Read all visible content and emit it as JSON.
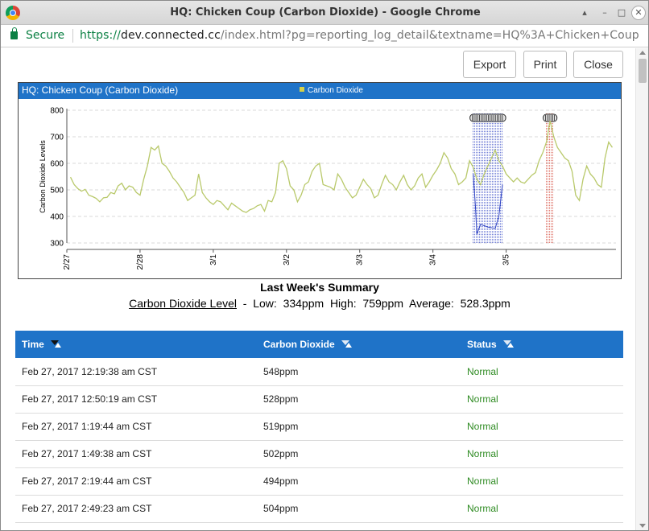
{
  "window": {
    "title": "HQ: Chicken Coup (Carbon Dioxide) - Google Chrome"
  },
  "address_bar": {
    "secure_label": "Secure",
    "url_scheme": "https://",
    "url_host": "dev.connected.cc",
    "url_rest": "/index.html?pg=reporting_log_detail&textname=HQ%3A+Chicken+Coup"
  },
  "toolbar": {
    "export_label": "Export",
    "print_label": "Print",
    "close_label": "Close"
  },
  "colors": {
    "header_blue": "#1f73c8",
    "series_line": "#b9c96b",
    "band_blue": "#2b3fc2",
    "band_red": "#d23b2b",
    "status_normal": "#2e8b22"
  },
  "chart": {
    "title": "HQ: Chicken Coup (Carbon Dioxide)",
    "legend_label": "Carbon Dioxide"
  },
  "chart_data": {
    "type": "line",
    "title": "HQ: Chicken Coup (Carbon Dioxide)",
    "ylabel": "Carbon Dioxide Levels",
    "xlabel": "",
    "ylim": [
      300,
      800
    ],
    "yticks": [
      300,
      400,
      500,
      600,
      700,
      800
    ],
    "grid": true,
    "legend": "top-center",
    "x_tick_labels": [
      "2/27",
      "2/28",
      "3/1",
      "3/2",
      "3/3",
      "3/4",
      "3/5"
    ],
    "x_range_days": [
      0,
      7.5
    ],
    "x_tick_days": [
      0,
      1,
      2,
      3,
      4,
      5,
      6
    ],
    "series": [
      {
        "name": "Carbon Dioxide",
        "points": [
          [
            0.05,
            548
          ],
          [
            0.1,
            520
          ],
          [
            0.15,
            505
          ],
          [
            0.2,
            495
          ],
          [
            0.25,
            502
          ],
          [
            0.3,
            480
          ],
          [
            0.35,
            475
          ],
          [
            0.4,
            468
          ],
          [
            0.45,
            455
          ],
          [
            0.5,
            470
          ],
          [
            0.55,
            472
          ],
          [
            0.6,
            490
          ],
          [
            0.65,
            485
          ],
          [
            0.7,
            515
          ],
          [
            0.75,
            525
          ],
          [
            0.8,
            500
          ],
          [
            0.85,
            515
          ],
          [
            0.9,
            510
          ],
          [
            0.95,
            490
          ],
          [
            1.0,
            480
          ],
          [
            1.05,
            540
          ],
          [
            1.1,
            590
          ],
          [
            1.15,
            660
          ],
          [
            1.2,
            650
          ],
          [
            1.25,
            665
          ],
          [
            1.3,
            600
          ],
          [
            1.35,
            590
          ],
          [
            1.4,
            570
          ],
          [
            1.45,
            545
          ],
          [
            1.5,
            530
          ],
          [
            1.55,
            510
          ],
          [
            1.6,
            490
          ],
          [
            1.65,
            460
          ],
          [
            1.7,
            470
          ],
          [
            1.75,
            480
          ],
          [
            1.8,
            560
          ],
          [
            1.85,
            490
          ],
          [
            1.9,
            470
          ],
          [
            1.95,
            455
          ],
          [
            2.0,
            445
          ],
          [
            2.05,
            460
          ],
          [
            2.1,
            455
          ],
          [
            2.15,
            440
          ],
          [
            2.2,
            425
          ],
          [
            2.25,
            450
          ],
          [
            2.3,
            440
          ],
          [
            2.35,
            430
          ],
          [
            2.4,
            420
          ],
          [
            2.45,
            415
          ],
          [
            2.5,
            425
          ],
          [
            2.55,
            430
          ],
          [
            2.6,
            440
          ],
          [
            2.65,
            445
          ],
          [
            2.7,
            420
          ],
          [
            2.75,
            460
          ],
          [
            2.8,
            455
          ],
          [
            2.85,
            490
          ],
          [
            2.9,
            600
          ],
          [
            2.95,
            610
          ],
          [
            3.0,
            580
          ],
          [
            3.05,
            515
          ],
          [
            3.1,
            500
          ],
          [
            3.15,
            455
          ],
          [
            3.2,
            480
          ],
          [
            3.25,
            520
          ],
          [
            3.3,
            530
          ],
          [
            3.35,
            570
          ],
          [
            3.4,
            590
          ],
          [
            3.45,
            600
          ],
          [
            3.5,
            520
          ],
          [
            3.55,
            515
          ],
          [
            3.6,
            510
          ],
          [
            3.65,
            500
          ],
          [
            3.7,
            560
          ],
          [
            3.75,
            540
          ],
          [
            3.8,
            510
          ],
          [
            3.85,
            490
          ],
          [
            3.9,
            470
          ],
          [
            3.95,
            480
          ],
          [
            4.0,
            510
          ],
          [
            4.05,
            540
          ],
          [
            4.1,
            520
          ],
          [
            4.15,
            505
          ],
          [
            4.2,
            470
          ],
          [
            4.25,
            480
          ],
          [
            4.3,
            520
          ],
          [
            4.35,
            555
          ],
          [
            4.4,
            530
          ],
          [
            4.45,
            520
          ],
          [
            4.5,
            500
          ],
          [
            4.55,
            530
          ],
          [
            4.6,
            555
          ],
          [
            4.65,
            520
          ],
          [
            4.7,
            500
          ],
          [
            4.75,
            515
          ],
          [
            4.8,
            545
          ],
          [
            4.85,
            560
          ],
          [
            4.9,
            510
          ],
          [
            4.95,
            530
          ],
          [
            5.0,
            555
          ],
          [
            5.05,
            575
          ],
          [
            5.1,
            600
          ],
          [
            5.15,
            640
          ],
          [
            5.2,
            620
          ],
          [
            5.25,
            580
          ],
          [
            5.3,
            560
          ],
          [
            5.35,
            520
          ],
          [
            5.4,
            530
          ],
          [
            5.45,
            545
          ],
          [
            5.5,
            610
          ],
          [
            5.55,
            585
          ],
          [
            5.6,
            540
          ],
          [
            5.65,
            520
          ],
          [
            5.7,
            560
          ],
          [
            5.75,
            590
          ],
          [
            5.8,
            620
          ],
          [
            5.85,
            650
          ],
          [
            5.9,
            610
          ],
          [
            5.95,
            590
          ],
          [
            6.0,
            560
          ],
          [
            6.05,
            545
          ],
          [
            6.1,
            530
          ],
          [
            6.15,
            545
          ],
          [
            6.2,
            530
          ],
          [
            6.25,
            525
          ],
          [
            6.3,
            540
          ],
          [
            6.35,
            555
          ],
          [
            6.4,
            565
          ],
          [
            6.45,
            610
          ],
          [
            6.5,
            640
          ],
          [
            6.55,
            680
          ],
          [
            6.6,
            760
          ],
          [
            6.65,
            700
          ],
          [
            6.7,
            660
          ],
          [
            6.75,
            640
          ],
          [
            6.8,
            620
          ],
          [
            6.85,
            610
          ],
          [
            6.9,
            570
          ],
          [
            6.95,
            480
          ],
          [
            7.0,
            460
          ],
          [
            7.05,
            540
          ],
          [
            7.1,
            590
          ],
          [
            7.15,
            560
          ],
          [
            7.2,
            545
          ],
          [
            7.25,
            520
          ],
          [
            7.3,
            510
          ],
          [
            7.35,
            620
          ],
          [
            7.4,
            680
          ],
          [
            7.45,
            660
          ]
        ]
      }
    ]
  },
  "summary": {
    "title": "Last Week's Summary",
    "metric_label": "Carbon Dioxide Level",
    "line_rest": "  -  Low:  334ppm  High:  759ppm  Average:  528.3ppm"
  },
  "table": {
    "columns": [
      "Time",
      "Carbon Dioxide",
      "Status"
    ],
    "rows": [
      {
        "time": "Feb 27, 2017 12:19:38 am CST",
        "co2": "548ppm",
        "status": "Normal"
      },
      {
        "time": "Feb 27, 2017 12:50:19 am CST",
        "co2": "528ppm",
        "status": "Normal"
      },
      {
        "time": "Feb 27, 2017 1:19:44 am CST",
        "co2": "519ppm",
        "status": "Normal"
      },
      {
        "time": "Feb 27, 2017 1:49:38 am CST",
        "co2": "502ppm",
        "status": "Normal"
      },
      {
        "time": "Feb 27, 2017 2:19:44 am CST",
        "co2": "494ppm",
        "status": "Normal"
      },
      {
        "time": "Feb 27, 2017 2:49:23 am CST",
        "co2": "504ppm",
        "status": "Normal"
      }
    ]
  }
}
